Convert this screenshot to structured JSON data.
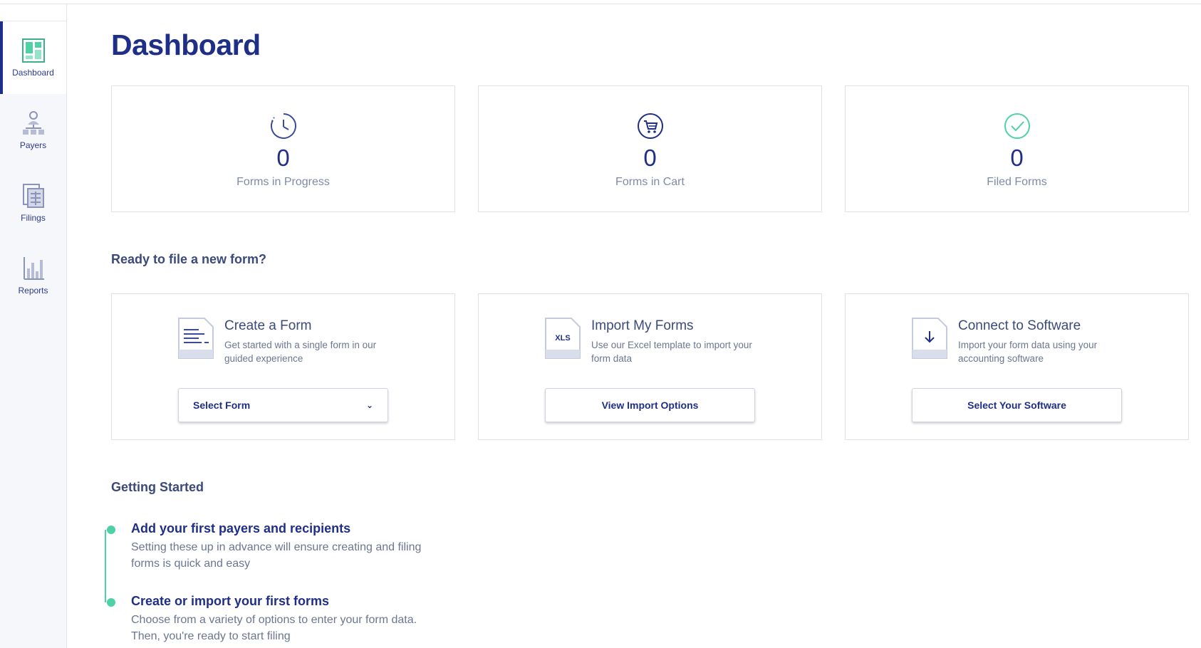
{
  "sidebar": {
    "items": [
      {
        "label": "Dashboard",
        "icon": "dashboard-icon",
        "active": true
      },
      {
        "label": "Payers",
        "icon": "payers-icon",
        "active": false
      },
      {
        "label": "Filings",
        "icon": "filings-icon",
        "active": false
      },
      {
        "label": "Reports",
        "icon": "reports-icon",
        "active": false
      }
    ]
  },
  "main": {
    "title": "Dashboard",
    "stats": [
      {
        "value": "0",
        "label": "Forms in Progress",
        "icon": "clock-icon"
      },
      {
        "value": "0",
        "label": "Forms in Cart",
        "icon": "cart-icon"
      },
      {
        "value": "0",
        "label": "Filed Forms",
        "icon": "check-circle-icon"
      }
    ],
    "new_form_heading": "Ready to file a new form?",
    "actions": [
      {
        "title": "Create a Form",
        "desc": "Get started with a single form in our guided experience",
        "button": "Select Form",
        "icon": "document-icon"
      },
      {
        "title": "Import My Forms",
        "desc": "Use our Excel template to import your form data",
        "button": "View Import Options",
        "icon": "xls-file-icon",
        "icon_text": "XLS"
      },
      {
        "title": "Connect to Software",
        "desc": "Import your form data using your accounting software",
        "button": "Select Your Software",
        "icon": "download-file-icon"
      }
    ],
    "getting_started_heading": "Getting Started",
    "steps": [
      {
        "title": "Add your first payers and recipients",
        "desc": "Setting these up in advance will ensure creating and filing forms is quick and easy"
      },
      {
        "title": "Create or import your first forms",
        "desc": "Choose from a variety of options to enter your form data. Then, you're ready to start filing"
      }
    ]
  },
  "colors": {
    "primary": "#1f2e86",
    "accent_green": "#4fd1a5",
    "muted_text": "#7f8aa6",
    "border": "#dfe1e8"
  }
}
